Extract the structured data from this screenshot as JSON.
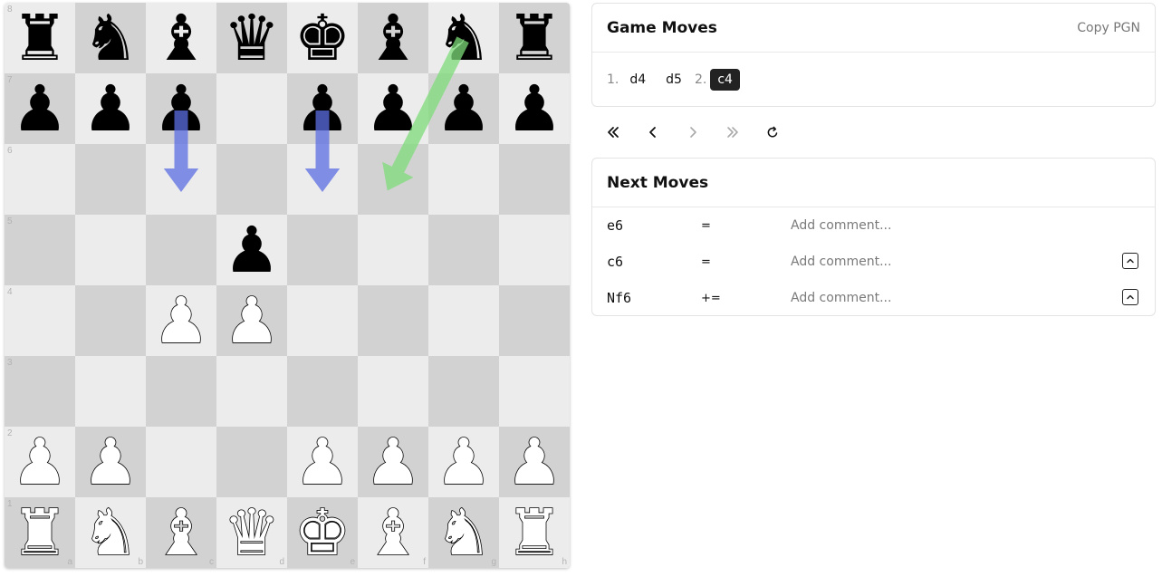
{
  "board": {
    "ranks": [
      "8",
      "7",
      "6",
      "5",
      "4",
      "3",
      "2",
      "1"
    ],
    "files": [
      "a",
      "b",
      "c",
      "d",
      "e",
      "f",
      "g",
      "h"
    ],
    "light_color": "#ececec",
    "dark_color": "#d2d2d2",
    "pieces": {
      "a8": "bR",
      "b8": "bN",
      "c8": "bB",
      "d8": "bQ",
      "e8": "bK",
      "f8": "bB",
      "g8": "bN",
      "h8": "bR",
      "a7": "bP",
      "b7": "bP",
      "c7": "bP",
      "e7": "bP",
      "f7": "bP",
      "g7": "bP",
      "h7": "bP",
      "d5": "bP",
      "c4": "wP",
      "d4": "wP",
      "a2": "wP",
      "b2": "wP",
      "e2": "wP",
      "f2": "wP",
      "g2": "wP",
      "h2": "wP",
      "a1": "wR",
      "b1": "wN",
      "c1": "wB",
      "d1": "wQ",
      "e1": "wK",
      "f1": "wB",
      "g1": "wN",
      "h1": "wR"
    },
    "arrows": [
      {
        "from": "c7",
        "to": "c6",
        "color": "#5b6ee1"
      },
      {
        "from": "e7",
        "to": "e6",
        "color": "#5b6ee1"
      },
      {
        "from": "g8",
        "to": "f6",
        "color": "#7ddc7a"
      }
    ]
  },
  "game_moves": {
    "title": "Game Moves",
    "copy_pgn_label": "Copy PGN",
    "moves": [
      {
        "number": "1.",
        "white": "d4",
        "black": "d5"
      },
      {
        "number": "2.",
        "white": "c4",
        "black": null
      }
    ],
    "active_move": "c4"
  },
  "navigation": {
    "buttons": [
      {
        "name": "first-move-icon"
      },
      {
        "name": "prev-move-icon"
      },
      {
        "name": "next-move-icon"
      },
      {
        "name": "last-move-icon"
      },
      {
        "name": "reset-icon"
      }
    ]
  },
  "next_moves": {
    "title": "Next Moves",
    "comment_placeholder": "Add comment...",
    "rows": [
      {
        "move": "e6",
        "eval": "=",
        "collapsible": false
      },
      {
        "move": "c6",
        "eval": "=",
        "collapsible": true
      },
      {
        "move": "Nf6",
        "eval": "+=",
        "collapsible": true
      }
    ]
  }
}
